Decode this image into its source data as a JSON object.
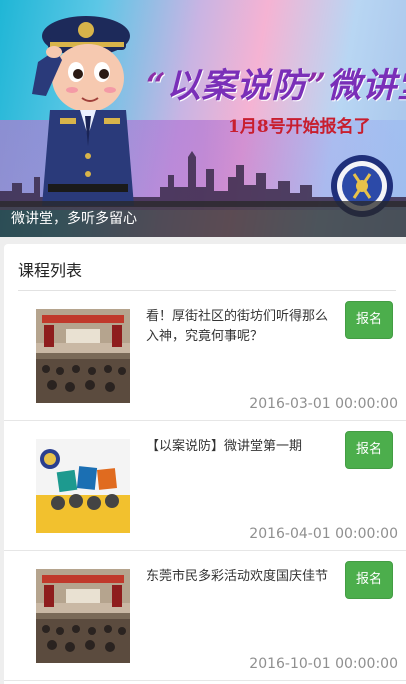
{
  "banner": {
    "title_open_quote": "“",
    "title": "以案说防",
    "title_close_quote": "”",
    "title_suffix": "微讲堂",
    "subtitle": "1月8号开始报名了",
    "caption": "微讲堂，多听多留心"
  },
  "course_list": {
    "header": "课程列表",
    "items": [
      {
        "title": "看！厚街社区的街坊们听得那么入神，究竟何事呢？",
        "button_label": "报名",
        "date": "2016-03-01 00:00:00",
        "thumb_icon": "meeting-hall-photo"
      },
      {
        "title": "【以案说防】微讲堂第一期",
        "button_label": "报名",
        "date": "2016-04-01 00:00:00",
        "thumb_icon": "poster-illustration"
      },
      {
        "title": "东莞市民多彩活动欢度国庆佳节",
        "button_label": "报名",
        "date": "2016-10-01 00:00:00",
        "thumb_icon": "meeting-hall-photo"
      }
    ]
  },
  "colors": {
    "accent_green": "#4cae4c",
    "title_purple": "#7a2fb8",
    "subtitle_red": "#c81e2e"
  }
}
